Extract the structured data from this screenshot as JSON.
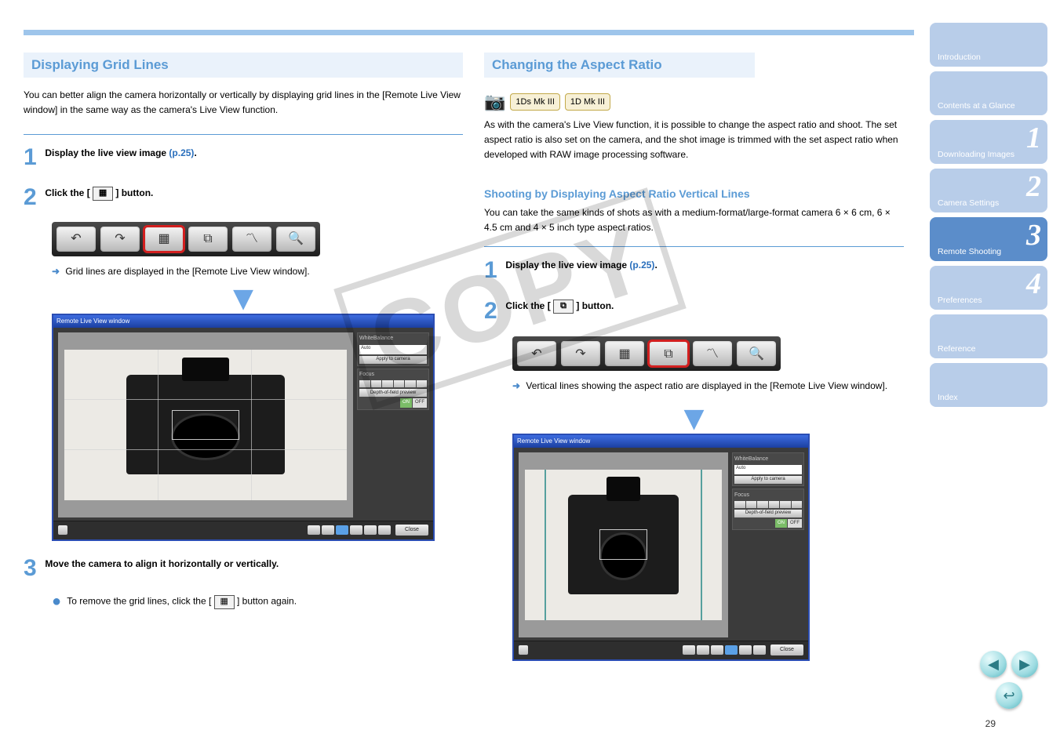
{
  "watermark": "COPY",
  "left": {
    "title": "Displaying Grid Lines",
    "intro": "You can better align the camera horizontally or vertically by displaying grid lines in the [Remote Live View window] in the same way as the camera's Live View function.",
    "step1": {
      "text1": "Display the live view image",
      "link_text": "(p.25)",
      "suffix": "."
    },
    "step2": {
      "text1": "Click the [",
      "text2": "] button."
    },
    "result": "Grid lines are displayed in the [Remote Live View window].",
    "step3": {
      "heading": "Move the camera to align it horizontally or vertically.",
      "bullet_pre": "To remove the grid lines, click the [",
      "bullet_suf": "] button again."
    },
    "app_title": "Remote Live View window",
    "panel": {
      "wb_label": "WhiteBalance",
      "wb_value": "Auto",
      "apply": "Apply to camera",
      "focus_label": "Focus",
      "dof": "Depth-of-field preview",
      "on": "ON",
      "off": "OFF",
      "close": "Close"
    }
  },
  "right": {
    "title": "Changing the Aspect Ratio",
    "badges": [
      "1Ds Mk III",
      "1D Mk III"
    ],
    "intro": "As with the camera's Live View function, it is possible to change the aspect ratio and shoot. The set aspect ratio is also set on the camera, and the shot image is trimmed with the set aspect ratio when developed with RAW image processing software.",
    "sub_heading": "Shooting by Displaying Aspect Ratio Vertical Lines",
    "sub_body": "You can take the same kinds of shots as with a medium-format/large-format camera 6 × 6 cm, 6 × 4.5 cm and 4 × 5 inch type aspect ratios.",
    "step1": {
      "text1": "Display the live view image",
      "link_text": "(p.25)",
      "suffix": "."
    },
    "step2": {
      "text1": "Click the [",
      "text2": "] button."
    },
    "result": "Vertical lines showing the aspect ratio are displayed in the [Remote Live View window].",
    "app_title": "Remote Live View window"
  },
  "sidenav": {
    "intro": "Introduction",
    "contents": "Contents at a Glance",
    "n1": {
      "num": "1",
      "label": "Downloading Images"
    },
    "n2": {
      "num": "2",
      "label": "Camera Settings"
    },
    "n3": {
      "num": "3",
      "label": "Remote Shooting"
    },
    "n4": {
      "num": "4",
      "label": "Preferences"
    },
    "ref": "Reference",
    "index": "Index"
  },
  "page_num": "29"
}
